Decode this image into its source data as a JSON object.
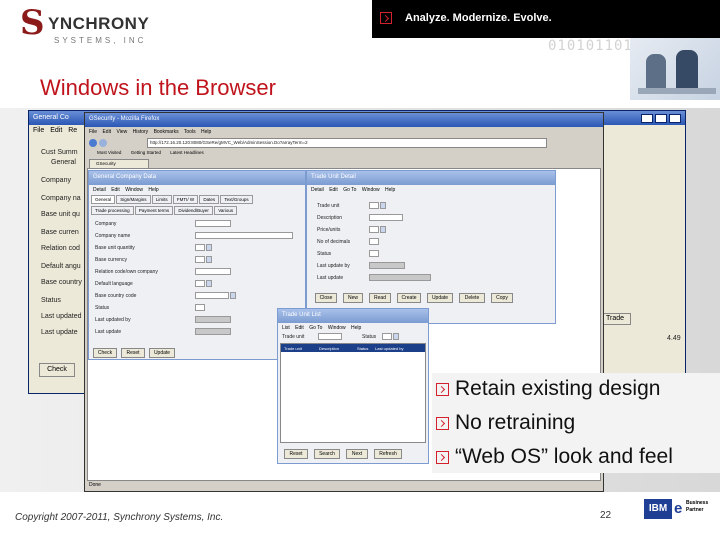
{
  "header": {
    "tagline": "Analyze. Modernize. Evolve.",
    "binary": "0101011010",
    "logo": {
      "name": "YNCHRONY",
      "initial": "S",
      "sub": "SYSTEMS, INC"
    }
  },
  "slide_title": "Windows in the Browser",
  "bullets": [
    "Retain existing design",
    "No retraining",
    "“Web OS” look and feel"
  ],
  "footer": {
    "copyright": "Copyright 2007-2011, Synchrony Systems, Inc.",
    "page": "22",
    "partner": {
      "brand": "IBM",
      "line1": "Business",
      "line2": "Partner"
    }
  },
  "screens": {
    "desktop_window": {
      "title": "General Co",
      "menu": [
        "File",
        "Edit",
        "Re"
      ],
      "labels": [
        "Cust Summ",
        "General",
        "Company",
        "Company na",
        "Base unit qu",
        "Base curren",
        "Relation cod",
        "Default angu",
        "Base country",
        "Status",
        "Last updated",
        "Last update"
      ],
      "button": "Check",
      "buttons_right": [
        "Trade",
        "4.49"
      ]
    },
    "browser": {
      "title": "GSecurity - Mozilla Firefox",
      "menu": [
        "File",
        "Edit",
        "View",
        "History",
        "Bookmarks",
        "Tools",
        "Help"
      ],
      "url": "http://172.16.20.120:8080/GSeRe/gMVC_Web/AdminSession.Do?arrayTerm=2",
      "bookmarks": [
        "Most Visited",
        "Getting Started",
        "Latest Headlines"
      ],
      "tab": "GSecurity",
      "status": "Done"
    },
    "general_company_data": {
      "title": "General Company Data",
      "menu": [
        "Detail",
        "Edit",
        "Window",
        "Help"
      ],
      "tabs": [
        "General",
        "Sign/Margins",
        "Limits",
        "FMTI/ W",
        "Dates",
        "Text/Groups"
      ],
      "subtabs": [
        "Trade processing",
        "Payment terms",
        "Dividend/Buyer",
        "Various"
      ],
      "fields": [
        "Company",
        "Company name",
        "Base unit quantity",
        "Base currency",
        "Relation code/own company",
        "Default language",
        "Base country code",
        "Status",
        "Last updated by",
        "Last update"
      ],
      "buttons": [
        "Check",
        "Reset",
        "Update"
      ]
    },
    "trade_unit_detail": {
      "title": "Trade Unit Detail",
      "menu": [
        "Detail",
        "Edit",
        "Go To",
        "Window",
        "Help"
      ],
      "fields": [
        "Trade unit",
        "Description",
        "Price/units",
        "No of decimals",
        "Status",
        "Last update by",
        "Last update"
      ],
      "buttons": [
        "Close",
        "New",
        "Read",
        "Create",
        "Update",
        "Delete",
        "Copy"
      ]
    },
    "trade_unit_list": {
      "title": "Trade Unit List",
      "menu": [
        "List",
        "Edit",
        "Go To",
        "Window",
        "Help"
      ],
      "labels": [
        "Trade unit",
        "Status"
      ],
      "columns": [
        "Trade unit",
        "Description",
        "Status",
        "Last updated by"
      ],
      "buttons": [
        "Reset",
        "Search",
        "Next",
        "Refresh"
      ]
    }
  }
}
